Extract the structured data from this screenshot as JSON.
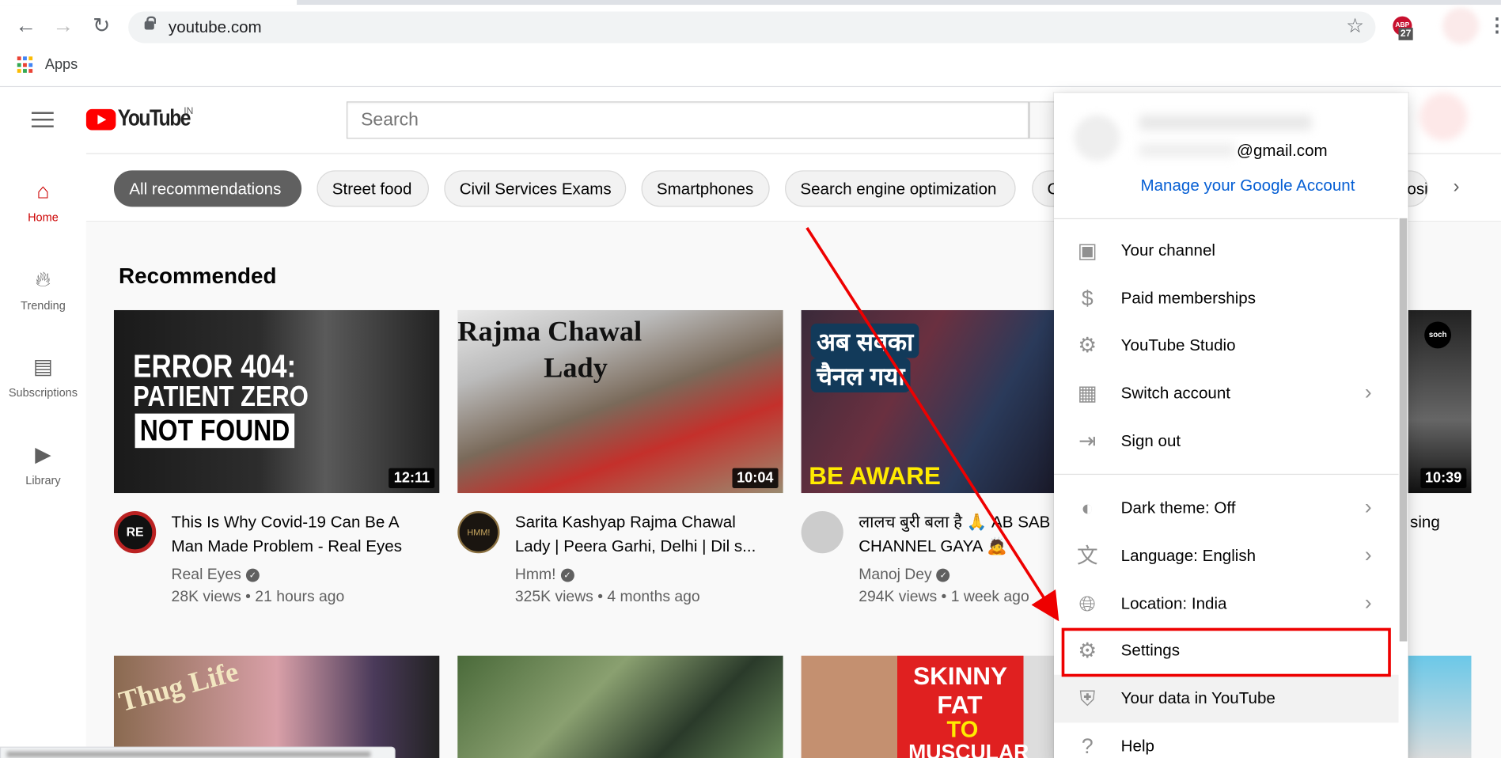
{
  "browser": {
    "url": "youtube.com",
    "bookmarks": [
      {
        "label": "Apps"
      }
    ],
    "extension_badge": "27",
    "extension_name": "ABP"
  },
  "header": {
    "logo": "YouTube",
    "country": "IN",
    "search_placeholder": "Search"
  },
  "chips": [
    {
      "label": "All recommendations",
      "selected": true
    },
    {
      "label": "Street food"
    },
    {
      "label": "Civil Services Exams"
    },
    {
      "label": "Smartphones"
    },
    {
      "label": "Search engine optimization"
    },
    {
      "label": "C"
    },
    {
      "label": "osit"
    }
  ],
  "sidebar": {
    "items": [
      {
        "label": "Home",
        "icon": "home-icon",
        "active": true
      },
      {
        "label": "Trending",
        "icon": "fire-icon"
      },
      {
        "label": "Subscriptions",
        "icon": "subscriptions-icon"
      },
      {
        "label": "Library",
        "icon": "library-icon"
      }
    ]
  },
  "main": {
    "section_title": "Recommended",
    "videos": [
      {
        "title": "This Is Why Covid-19 Can Be A Man Made Problem - Real Eyes",
        "channel": "Real Eyes",
        "meta": "28K views • 21 hours ago",
        "duration": "12:11",
        "thumb_text": [
          "ERROR 404:",
          "PATIENT ZERO",
          "NOT FOUND"
        ],
        "avatar_text": "RE"
      },
      {
        "title": "Sarita Kashyap Rajma Chawal Lady | Peera Garhi, Delhi | Dil s...",
        "channel": "Hmm!",
        "meta": "325K views • 4 months ago",
        "duration": "10:04",
        "thumb_text": [
          "Rajma Chawal",
          "Lady"
        ],
        "avatar_text": "HMM!"
      },
      {
        "title": "लालच बुरी बला है 🙏 AB SAB CHANNEL GAYA 🙇",
        "channel": "Manoj Dey",
        "meta": "294K views • 1 week ago",
        "duration": "",
        "thumb_text": [
          "अब सबका",
          "चैनल गया",
          "BE AWARE"
        ]
      },
      {
        "title": "sing",
        "duration": "10:39",
        "thumb_text": [
          "soch"
        ]
      }
    ],
    "row2_thumb_text": [
      "Thug Life",
      "SKINNY",
      "FAT",
      "TO",
      "MUSCULAR"
    ]
  },
  "account_menu": {
    "email": "@gmail.com",
    "manage_link": "Manage your Google Account",
    "items": [
      {
        "label": "Your channel",
        "icon": "account-box-icon"
      },
      {
        "label": "Paid memberships",
        "icon": "dollar-icon"
      },
      {
        "label": "YouTube Studio",
        "icon": "gear-icon"
      },
      {
        "label": "Switch account",
        "icon": "switch-account-icon",
        "chevron": true
      },
      {
        "label": "Sign out",
        "icon": "sign-out-icon"
      },
      {
        "label": "Dark theme: Off",
        "icon": "dark-theme-icon",
        "chevron": true
      },
      {
        "label": "Language: English",
        "icon": "translate-icon",
        "chevron": true
      },
      {
        "label": "Location: India",
        "icon": "globe-icon",
        "chevron": true
      },
      {
        "label": "Settings",
        "icon": "gear-icon",
        "highlighted": true
      },
      {
        "label": "Your data in YouTube",
        "icon": "shield-icon",
        "hover": true
      },
      {
        "label": "Help",
        "icon": "help-icon"
      }
    ]
  },
  "colors": {
    "accent": "#ff0000",
    "link": "#065fd4",
    "annotation": "#e00000"
  }
}
